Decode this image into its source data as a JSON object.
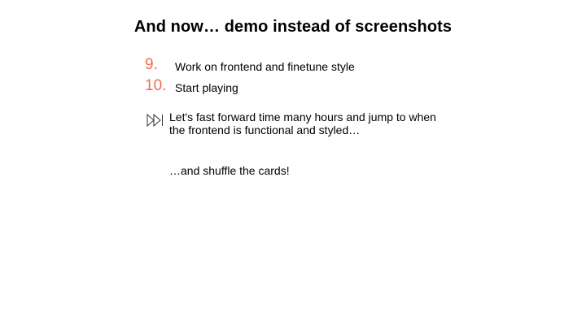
{
  "slide": {
    "title": "And now… demo instead of screenshots",
    "steps": [
      {
        "number": "9.",
        "text": "Work on frontend and finetune style"
      },
      {
        "number": "10.",
        "text": "Start playing"
      }
    ],
    "fast_forward": {
      "icon": "fast-forward-icon",
      "line1": "Let's fast forward time many hours and jump to when",
      "line2": "the frontend is functional and styled…"
    },
    "shuffle_text": "…and shuffle the cards!",
    "colors": {
      "accent": "#f26a4f",
      "text": "#000000",
      "background": "#ffffff"
    }
  }
}
